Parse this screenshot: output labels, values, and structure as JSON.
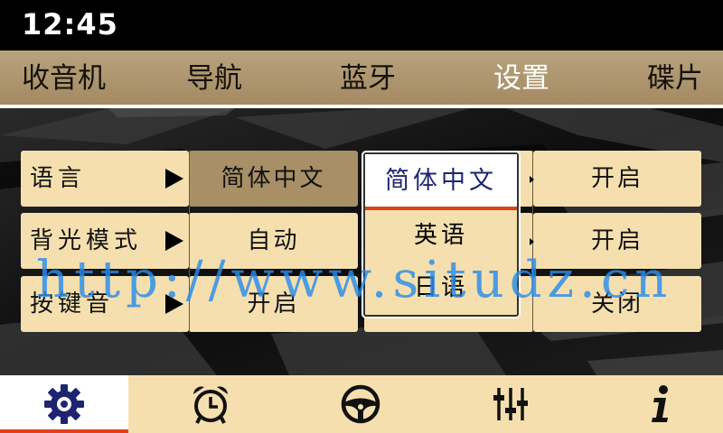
{
  "status": {
    "time": "12:45"
  },
  "nav": {
    "tabs": [
      {
        "label": "收音机"
      },
      {
        "label": "导航"
      },
      {
        "label": "蓝牙"
      },
      {
        "label": "设置",
        "active": true
      },
      {
        "label": "碟片"
      }
    ]
  },
  "settings": {
    "rows": [
      {
        "label": "语言",
        "value": "简体中文"
      },
      {
        "label": "背光模式",
        "value": "自动"
      },
      {
        "label": "按键音",
        "value": "开启"
      }
    ],
    "right_values": [
      "开启",
      "开启",
      "关闭"
    ]
  },
  "dropdown": {
    "options": [
      "简体中文",
      "英语",
      "日语"
    ],
    "selected": "简体中文"
  },
  "watermark": "http://www.situdz.cn",
  "dock": {
    "items": [
      {
        "icon": "gear-icon",
        "active": true
      },
      {
        "icon": "alarm-clock-icon"
      },
      {
        "icon": "steering-wheel-icon"
      },
      {
        "icon": "equalizer-icon"
      },
      {
        "icon": "info-icon"
      }
    ]
  },
  "colors": {
    "nav_bg": "#b09671",
    "cell_bg": "#f5dfae",
    "cell_selected_bg": "#a88f66",
    "accent": "#e2401c",
    "icon_active": "#1d2570"
  }
}
